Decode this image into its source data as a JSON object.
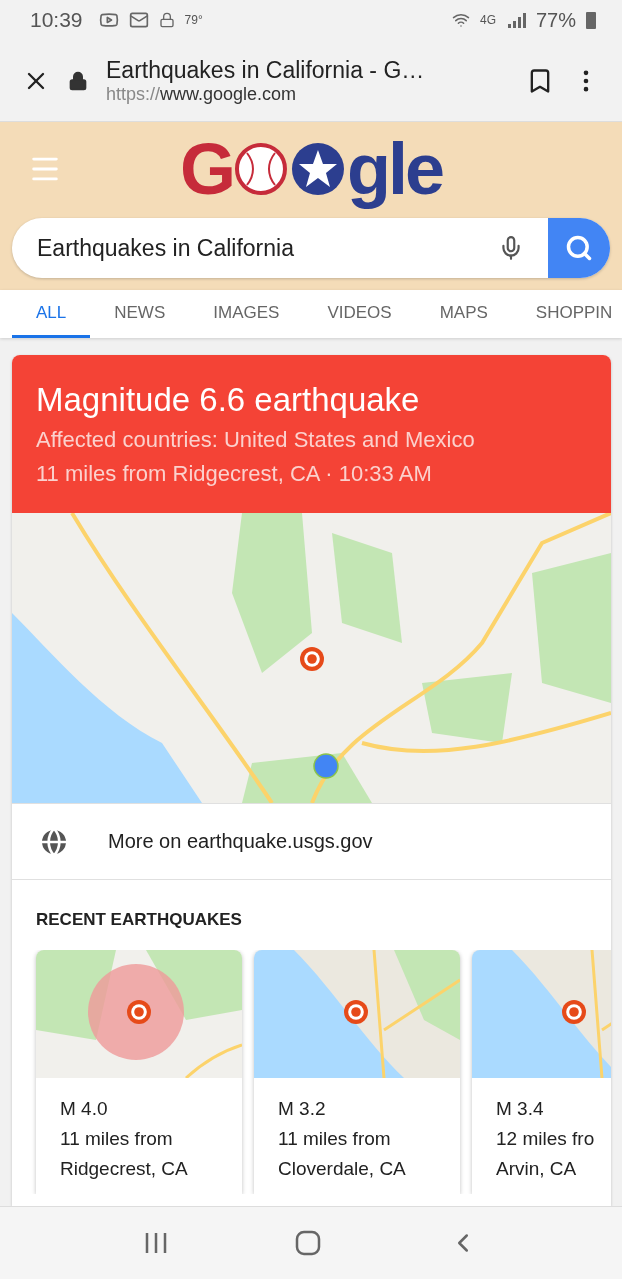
{
  "status_bar": {
    "time": "10:39",
    "temperature": "79°",
    "network": "4G",
    "battery": "77%"
  },
  "browser": {
    "title": "Earthquakes in California - G…",
    "url_scheme": "https://",
    "url_host": "www.google.com"
  },
  "logo": {
    "lead": "G",
    "tail": "gle"
  },
  "search": {
    "value": "Earthquakes in California"
  },
  "tabs": [
    {
      "label": "ALL",
      "selected": true
    },
    {
      "label": "NEWS",
      "selected": false
    },
    {
      "label": "IMAGES",
      "selected": false
    },
    {
      "label": "VIDEOS",
      "selected": false
    },
    {
      "label": "MAPS",
      "selected": false
    },
    {
      "label": "SHOPPIN",
      "selected": false
    }
  ],
  "quake": {
    "title": "Magnitude 6.6 earthquake",
    "affected": "Affected countries: United States and Mexico",
    "location": "11 miles from Ridgecrest, CA · 10:33 AM",
    "more_link": "More on earthquake.usgs.gov"
  },
  "recent": {
    "heading": "RECENT EARTHQUAKES",
    "items": [
      {
        "magnitude": "M 4.0",
        "distance": "11 miles from",
        "place": "Ridgecrest, CA"
      },
      {
        "magnitude": "M 3.2",
        "distance": "11 miles from",
        "place": "Cloverdale, CA"
      },
      {
        "magnitude": "M 3.4",
        "distance": "12 miles fro",
        "place": "Arvin, CA"
      }
    ]
  }
}
